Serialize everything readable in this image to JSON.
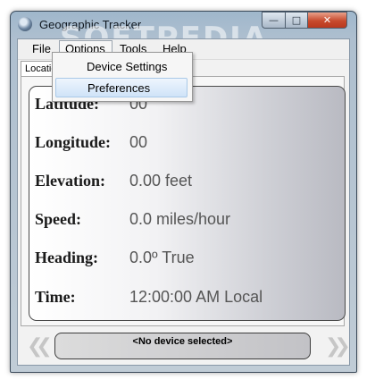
{
  "window": {
    "title": "Geographic Tracker"
  },
  "menu": {
    "file": "File",
    "options": "Options",
    "tools": "Tools",
    "help": "Help"
  },
  "dropdown": {
    "device_settings": "Device Settings",
    "preferences": "Preferences"
  },
  "tab": {
    "label": "Location"
  },
  "watermark": "SOFTPEDIA",
  "fields": [
    {
      "label": "Latitude:",
      "value": "00"
    },
    {
      "label": "Longitude:",
      "value": "00"
    },
    {
      "label": "Elevation:",
      "value": "0.00 feet"
    },
    {
      "label": "Speed:",
      "value": "0.0 miles/hour"
    },
    {
      "label": "Heading:",
      "value": "0.0º True"
    },
    {
      "label": "Time:",
      "value": "12:00:00 AM Local"
    }
  ],
  "device": {
    "status": "<No device selected>"
  }
}
